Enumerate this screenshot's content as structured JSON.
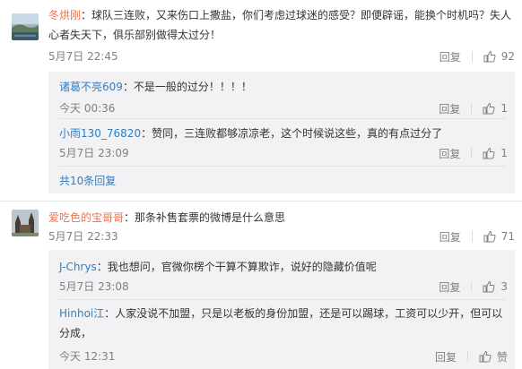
{
  "comments": [
    {
      "user": "冬烘刚",
      "text": "：球队三连败，又来伤口上撒盐，你们考虑过球迷的感受？即便辟谣，能换个时机吗？失人心者失天下，俱乐部别做得太过分！",
      "text_line1": "：球队三连败，又来伤口上撒盐，你们考虑过球迷的感受？即便辟谣，能换个时机吗？失人",
      "text_line2": "心者失天下，俱乐部别做得太过分！",
      "time": "5月7日 22:45",
      "reply_label": "回复",
      "like_count": "92",
      "replies": [
        {
          "user": "诸葛不亮609",
          "text": "：不是一般的过分！！！！",
          "time": "今天 00:36",
          "reply_label": "回复",
          "like_count": "1"
        },
        {
          "user": "小雨130_76820",
          "text": "：赞同，三连败都够凉凉老，这个时候说这些，真的有点过分了",
          "time": "5月7日 23:09",
          "reply_label": "回复",
          "like_count": "1"
        }
      ],
      "more_label": "共10条回复"
    },
    {
      "user": "爱吃色的宝哥哥",
      "text": "：那条补售套票的微博是什么意思",
      "time": "5月7日 22:33",
      "reply_label": "回复",
      "like_count": "71",
      "replies": [
        {
          "user": "J-Chrys",
          "text": "：我也想问，官微你楞个干算不算欺诈，说好的隐藏价值呢",
          "time": "5月7日 23:08",
          "reply_label": "回复",
          "like_count": "3"
        },
        {
          "user": "Hinhoi江",
          "text_line1": "：人家没说不加盟，只是以老板的身份加盟，还是可以踢球，工资可以少开，但可以",
          "text_line2": "分成，",
          "time": "今天 12:31",
          "reply_label": "回复",
          "like_count": "赞"
        }
      ]
    }
  ],
  "colors": {
    "username_main": "#eb7350",
    "username_reply": "#2f7fc2",
    "meta": "#808080",
    "reply_bg": "#f2f2f5"
  },
  "icons": {
    "like": "thumbs-up-icon"
  }
}
